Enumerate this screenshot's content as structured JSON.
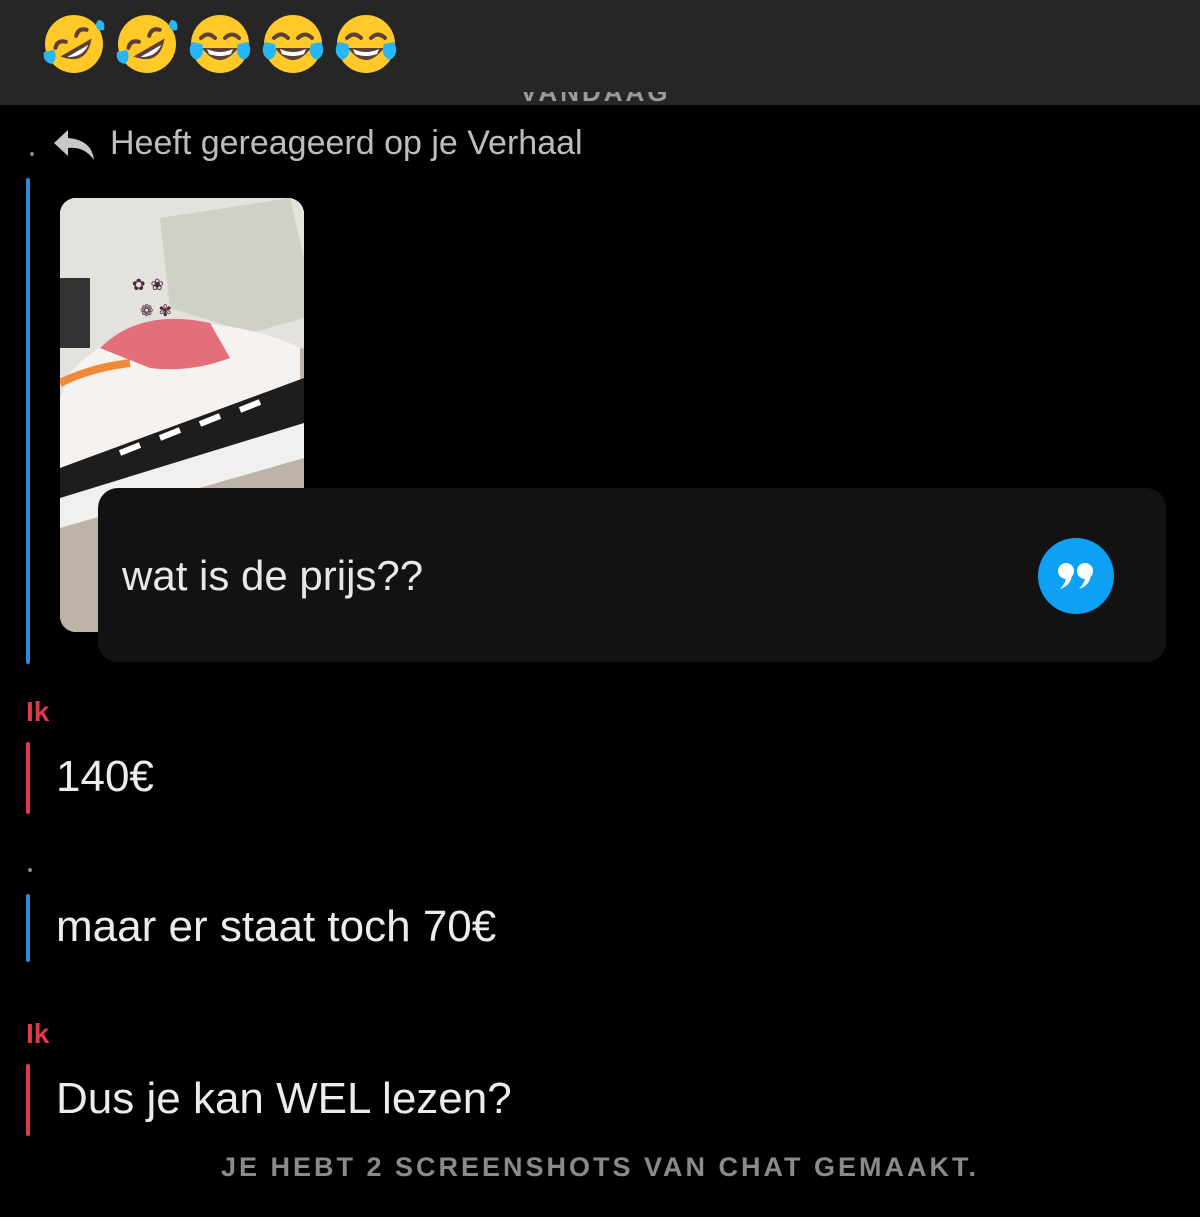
{
  "top_bar": {
    "emojis": [
      "rolling-on-floor-laughing",
      "rolling-on-floor-laughing",
      "tears-of-joy",
      "tears-of-joy",
      "tears-of-joy"
    ]
  },
  "chat": {
    "date_header": "VANDAAG",
    "reaction_label": "Heeft gereageerd op je Verhaal",
    "story_reply": {
      "message": "wat is de prijs??",
      "quote_icon": "quote-icon"
    },
    "messages": [
      {
        "sender": "Ik",
        "text": "140€",
        "color": "#e2394a"
      },
      {
        "sender": "",
        "text": "maar er staat toch 70€",
        "color": "#2f8bd6"
      },
      {
        "sender": "Ik",
        "text": "Dus je kan WEL lezen?",
        "color": "#e2394a"
      }
    ],
    "screenshot_notice": "JE HEBT 2 SCREENSHOTS VAN CHAT GEMAAKT."
  },
  "colors": {
    "me": "#e2394a",
    "them": "#2f8bd6",
    "quote_button": "#0ea1f3"
  }
}
